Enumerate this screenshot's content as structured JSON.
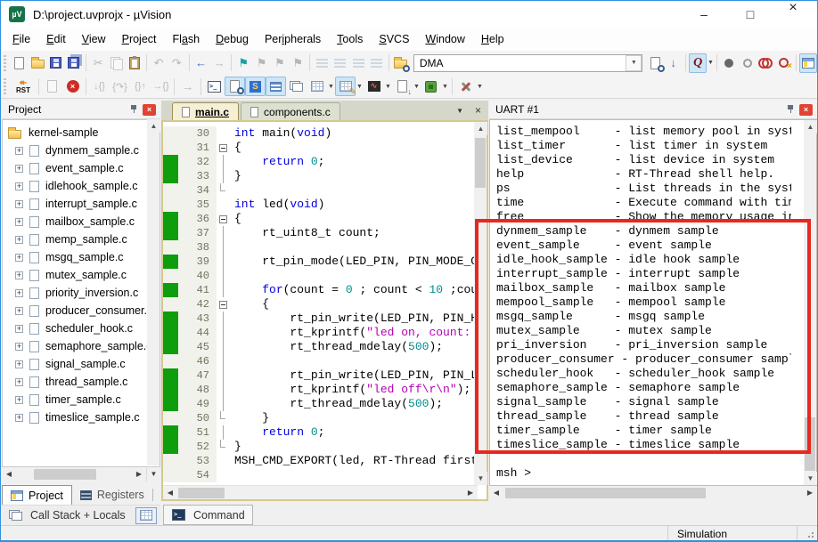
{
  "window": {
    "title": "D:\\project.uvprojx - µVision",
    "app_icon_text": "µV"
  },
  "menu": {
    "items": [
      {
        "t": "File",
        "a": 0
      },
      {
        "t": "Edit",
        "a": 0
      },
      {
        "t": "View",
        "a": 0
      },
      {
        "t": "Project",
        "a": 0
      },
      {
        "t": "Flash",
        "a": 2
      },
      {
        "t": "Debug",
        "a": 0
      },
      {
        "t": "Peripherals",
        "a": 3
      },
      {
        "t": "Tools",
        "a": 0
      },
      {
        "t": "SVCS",
        "a": 0
      },
      {
        "t": "Window",
        "a": 0
      },
      {
        "t": "Help",
        "a": 0
      }
    ]
  },
  "toolbar1": {
    "find_text": "DMA"
  },
  "toolbar2": {
    "rst_label": "RST"
  },
  "project_panel": {
    "title": "Project",
    "root": "kernel-sample",
    "files": [
      "dynmem_sample.c",
      "event_sample.c",
      "idlehook_sample.c",
      "interrupt_sample.c",
      "mailbox_sample.c",
      "memp_sample.c",
      "msgq_sample.c",
      "mutex_sample.c",
      "priority_inversion.c",
      "producer_consumer.c",
      "scheduler_hook.c",
      "semaphore_sample.c",
      "signal_sample.c",
      "thread_sample.c",
      "timer_sample.c",
      "timeslice_sample.c"
    ],
    "tabs": [
      {
        "label": "Project"
      },
      {
        "label": "Registers"
      }
    ]
  },
  "bottom": {
    "callstack_label": "Call Stack + Locals",
    "command_label": "Command"
  },
  "editor": {
    "tabs": [
      {
        "label": "main.c"
      },
      {
        "label": "components.c"
      }
    ],
    "lines": [
      {
        "no": 30,
        "chg": false,
        "fold": "",
        "segs": [
          [
            "k",
            "int"
          ],
          [
            "p",
            " main("
          ],
          [
            "k",
            "void"
          ],
          [
            "p",
            ")"
          ]
        ]
      },
      {
        "no": 31,
        "chg": false,
        "fold": "box",
        "segs": [
          [
            "p",
            "{"
          ]
        ]
      },
      {
        "no": 32,
        "chg": true,
        "fold": "line",
        "segs": [
          [
            "p",
            "    "
          ],
          [
            "k",
            "return"
          ],
          [
            "p",
            " "
          ],
          [
            "n",
            "0"
          ],
          [
            "p",
            ";"
          ]
        ]
      },
      {
        "no": 33,
        "chg": true,
        "fold": "line",
        "segs": [
          [
            "p",
            "}"
          ]
        ]
      },
      {
        "no": 34,
        "chg": false,
        "fold": "end",
        "segs": []
      },
      {
        "no": 35,
        "chg": false,
        "fold": "",
        "segs": [
          [
            "k",
            "int"
          ],
          [
            "p",
            " led("
          ],
          [
            "k",
            "void"
          ],
          [
            "p",
            ")"
          ]
        ]
      },
      {
        "no": 36,
        "chg": true,
        "fold": "box",
        "segs": [
          [
            "p",
            "{"
          ]
        ]
      },
      {
        "no": 37,
        "chg": true,
        "fold": "line",
        "segs": [
          [
            "p",
            "    rt_uint8_t count;"
          ]
        ]
      },
      {
        "no": 38,
        "chg": false,
        "fold": "line",
        "segs": []
      },
      {
        "no": 39,
        "chg": true,
        "fold": "line",
        "segs": [
          [
            "p",
            "    rt_pin_mode(LED_PIN, PIN_MODE_OUTPUT);"
          ]
        ]
      },
      {
        "no": 40,
        "chg": false,
        "fold": "line",
        "segs": []
      },
      {
        "no": 41,
        "chg": true,
        "fold": "line",
        "segs": [
          [
            "p",
            "    "
          ],
          [
            "k",
            "for"
          ],
          [
            "p",
            "(count = "
          ],
          [
            "n",
            "0"
          ],
          [
            "p",
            " ; count < "
          ],
          [
            "n",
            "10"
          ],
          [
            "p",
            " ;count++)"
          ]
        ]
      },
      {
        "no": 42,
        "chg": false,
        "fold": "box",
        "segs": [
          [
            "p",
            "    {"
          ]
        ]
      },
      {
        "no": 43,
        "chg": true,
        "fold": "line",
        "segs": [
          [
            "p",
            "        rt_pin_write(LED_PIN, PIN_HIGH);"
          ]
        ]
      },
      {
        "no": 44,
        "chg": true,
        "fold": "line",
        "segs": [
          [
            "p",
            "        rt_kprintf("
          ],
          [
            "s",
            "\"led on, count: %d\\r\\n\""
          ],
          [
            "p",
            ", count);"
          ]
        ]
      },
      {
        "no": 45,
        "chg": true,
        "fold": "line",
        "segs": [
          [
            "p",
            "        rt_thread_mdelay("
          ],
          [
            "n",
            "500"
          ],
          [
            "p",
            ");"
          ]
        ]
      },
      {
        "no": 46,
        "chg": false,
        "fold": "line",
        "segs": []
      },
      {
        "no": 47,
        "chg": true,
        "fold": "line",
        "segs": [
          [
            "p",
            "        rt_pin_write(LED_PIN, PIN_LOW);"
          ]
        ]
      },
      {
        "no": 48,
        "chg": true,
        "fold": "line",
        "segs": [
          [
            "p",
            "        rt_kprintf("
          ],
          [
            "s",
            "\"led off\\r\\n\""
          ],
          [
            "p",
            ");"
          ]
        ]
      },
      {
        "no": 49,
        "chg": true,
        "fold": "line",
        "segs": [
          [
            "p",
            "        rt_thread_mdelay("
          ],
          [
            "n",
            "500"
          ],
          [
            "p",
            ");"
          ]
        ]
      },
      {
        "no": 50,
        "chg": false,
        "fold": "end",
        "segs": [
          [
            "p",
            "    }"
          ]
        ]
      },
      {
        "no": 51,
        "chg": true,
        "fold": "line",
        "segs": [
          [
            "p",
            "    "
          ],
          [
            "k",
            "return"
          ],
          [
            "p",
            " "
          ],
          [
            "n",
            "0"
          ],
          [
            "p",
            ";"
          ]
        ]
      },
      {
        "no": 52,
        "chg": true,
        "fold": "end",
        "segs": [
          [
            "p",
            "}"
          ]
        ]
      },
      {
        "no": 53,
        "chg": false,
        "fold": "",
        "segs": [
          [
            "p",
            "MSH_CMD_EXPORT(led, RT-Thread first led);"
          ]
        ]
      },
      {
        "no": 54,
        "chg": false,
        "fold": "",
        "segs": []
      }
    ]
  },
  "uart": {
    "title": "UART #1",
    "lines": [
      "list_mempool     - list memory pool in system",
      "list_timer       - list timer in system",
      "list_device      - list device in system",
      "help             - RT-Thread shell help.",
      "ps               - List threads in the system.",
      "time             - Execute command with time.",
      "free             - Show the memory usage in the system.",
      "dynmem_sample    - dynmem sample",
      "event_sample     - event sample",
      "idle_hook_sample - idle hook sample",
      "interrupt_sample - interrupt sample",
      "mailbox_sample   - mailbox sample",
      "mempool_sample   - mempool sample",
      "msgq_sample      - msgq sample",
      "mutex_sample     - mutex sample",
      "pri_inversion    - pri_inversion sample",
      "producer_consumer - producer_consumer sample",
      "scheduler_hook   - scheduler_hook sample",
      "semaphore_sample - semaphore sample",
      "signal_sample    - signal sample",
      "thread_sample    - thread sample",
      "timer_sample     - timer sample",
      "timeslice_sample - timeslice sample",
      "",
      "msh >"
    ]
  },
  "statusbar": {
    "mode": "Simulation"
  },
  "colors": {
    "window_border": "#3390dd",
    "annotation_red": "#e8281e",
    "change_bar_green": "#0d9d0d",
    "keyword": "#0000dd",
    "number": "#008f8f",
    "string": "#b400b4",
    "tab_active_bg": "#f5efd6",
    "toggle_highlight_bg": "#cde6f7"
  }
}
